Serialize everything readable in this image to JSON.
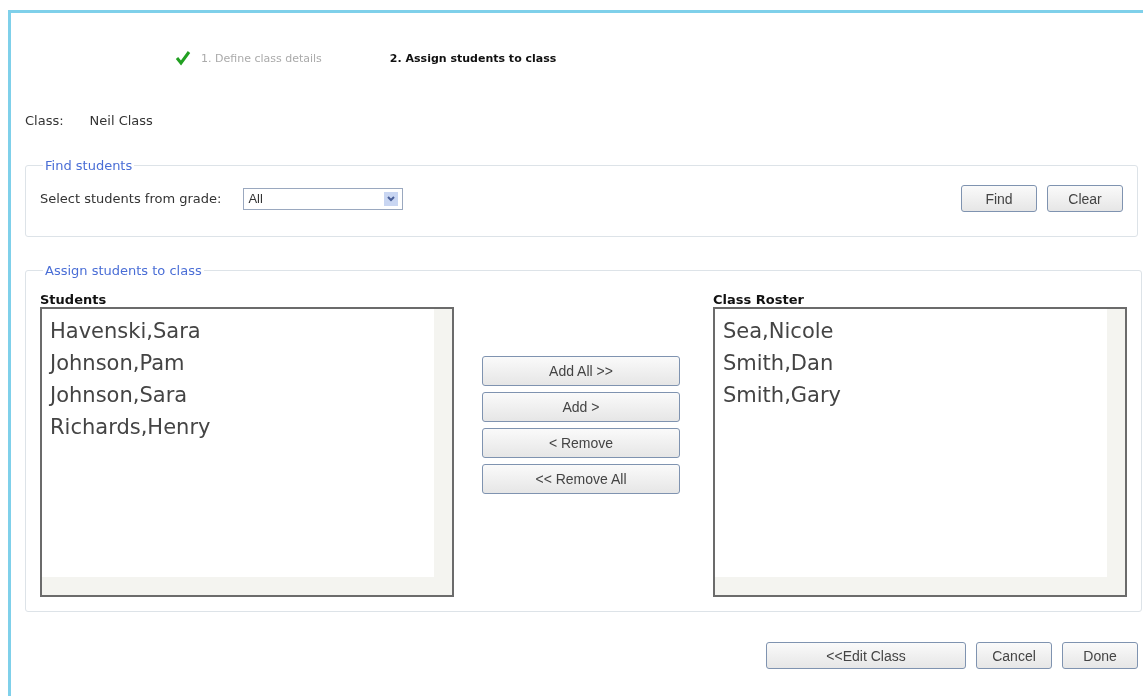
{
  "steps": [
    {
      "label": "1. Define class details",
      "done": true,
      "selected": false
    },
    {
      "label": "2. Assign students to class",
      "done": false,
      "selected": true
    }
  ],
  "class_field": {
    "label": "Class:",
    "value": "Neil Class"
  },
  "find_students": {
    "legend": "Find students",
    "grade_label": "Select students from grade:",
    "grade_value": "All",
    "buttons": [
      "Find",
      "Clear"
    ]
  },
  "assign": {
    "legend": "Assign students to class",
    "students": {
      "heading": "Students",
      "items": [
        "Havenski,Sara",
        "Johnson,Pam",
        "Johnson,Sara",
        "Richards,Henry"
      ]
    },
    "move_buttons": [
      "Add All >>",
      "Add >",
      "< Remove",
      "<< Remove All"
    ],
    "roster": {
      "heading": "Class Roster",
      "items": [
        "Sea,Nicole",
        "Smith,Dan",
        "Smith,Gary"
      ]
    }
  },
  "footer_buttons": [
    "<<Edit Class",
    "Cancel",
    "Done"
  ]
}
